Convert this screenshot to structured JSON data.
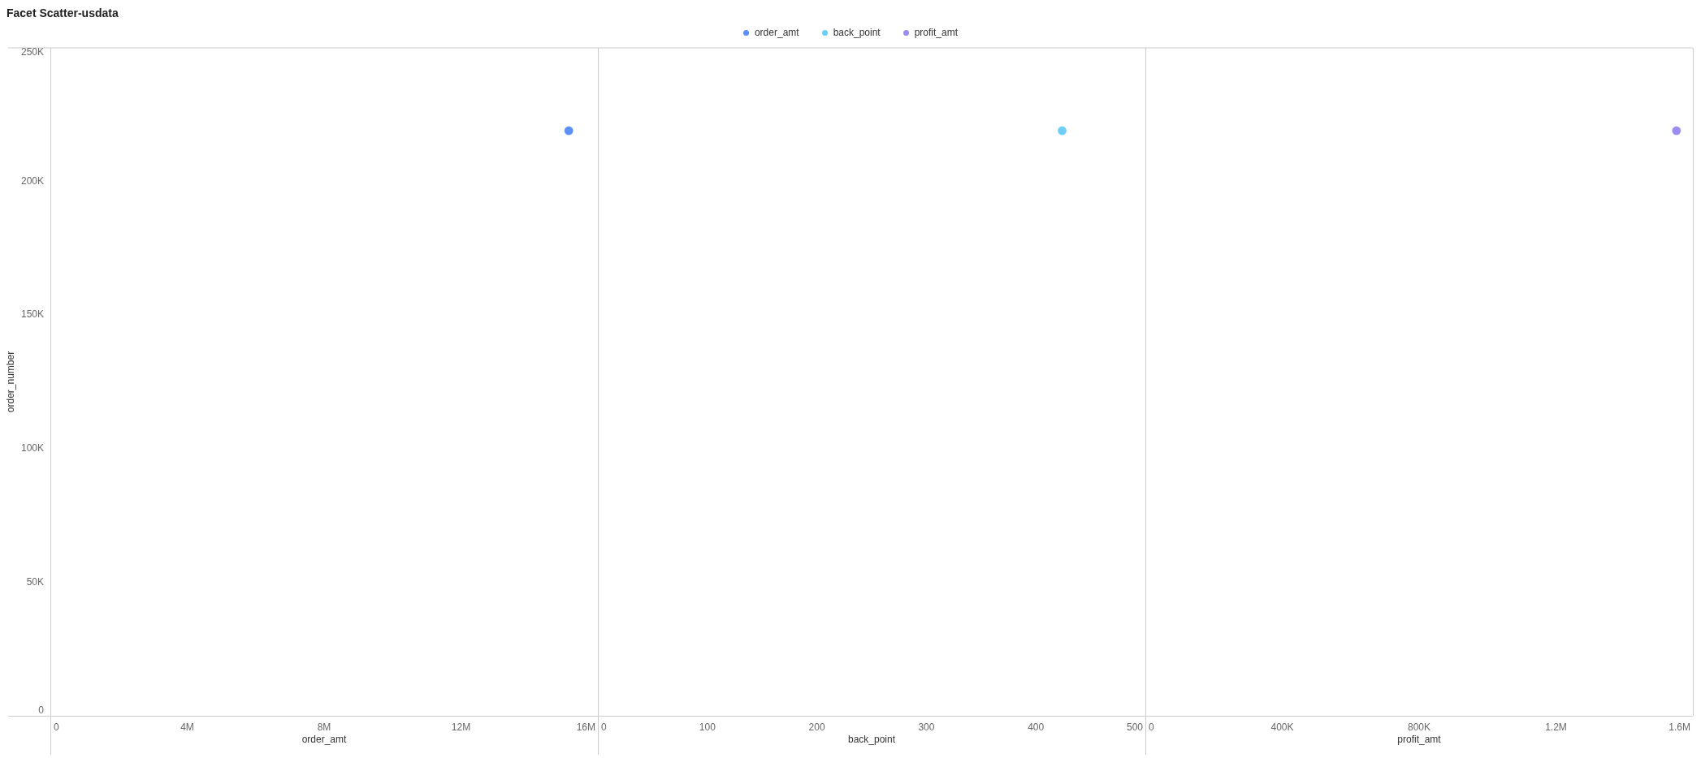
{
  "title": "Facet Scatter-usdata",
  "legend": [
    {
      "label": "order_amt",
      "color": "#5b8ff9"
    },
    {
      "label": "back_point",
      "color": "#6dcff6"
    },
    {
      "label": "profit_amt",
      "color": "#9a8cf0"
    }
  ],
  "facets": [
    {
      "chart_data": {
        "type": "scatter",
        "xlabel": "order_amt",
        "ylabel": "order_number",
        "xlim": [
          0,
          16000000
        ],
        "ylim": [
          0,
          250000
        ],
        "xticks": [
          {
            "value": 0,
            "label": "0"
          },
          {
            "value": 4000000,
            "label": "4M"
          },
          {
            "value": 8000000,
            "label": "8M"
          },
          {
            "value": 12000000,
            "label": "12M"
          },
          {
            "value": 16000000,
            "label": "16M"
          }
        ],
        "yticks": [
          {
            "value": 0,
            "label": "0"
          },
          {
            "value": 50000,
            "label": "50K"
          },
          {
            "value": 100000,
            "label": "100K"
          },
          {
            "value": 150000,
            "label": "150K"
          },
          {
            "value": 200000,
            "label": "200K"
          },
          {
            "value": 250000,
            "label": "250K"
          }
        ],
        "x": [
          15150000
        ],
        "series": [
          {
            "color": "#5b8ff9",
            "values": [
              219000
            ]
          }
        ]
      }
    },
    {
      "chart_data": {
        "type": "scatter",
        "xlabel": "back_point",
        "xlim": [
          0,
          500
        ],
        "ylim": [
          0,
          250000
        ],
        "xticks": [
          {
            "value": 0,
            "label": "0"
          },
          {
            "value": 100,
            "label": "100"
          },
          {
            "value": 200,
            "label": "200"
          },
          {
            "value": 300,
            "label": "300"
          },
          {
            "value": 400,
            "label": "400"
          },
          {
            "value": 500,
            "label": "500"
          }
        ],
        "x": [
          424
        ],
        "series": [
          {
            "color": "#6dcff6",
            "values": [
              219000
            ]
          }
        ]
      }
    },
    {
      "chart_data": {
        "type": "scatter",
        "xlabel": "profit_amt",
        "xlim": [
          0,
          1600000
        ],
        "ylim": [
          0,
          250000
        ],
        "xticks": [
          {
            "value": 0,
            "label": "0"
          },
          {
            "value": 400000,
            "label": "400K"
          },
          {
            "value": 800000,
            "label": "800K"
          },
          {
            "value": 1200000,
            "label": "1.2M"
          },
          {
            "value": 1600000,
            "label": "1.6M"
          }
        ],
        "x": [
          1552000
        ],
        "series": [
          {
            "color": "#9a8cf0",
            "values": [
              219000
            ]
          }
        ]
      }
    }
  ]
}
